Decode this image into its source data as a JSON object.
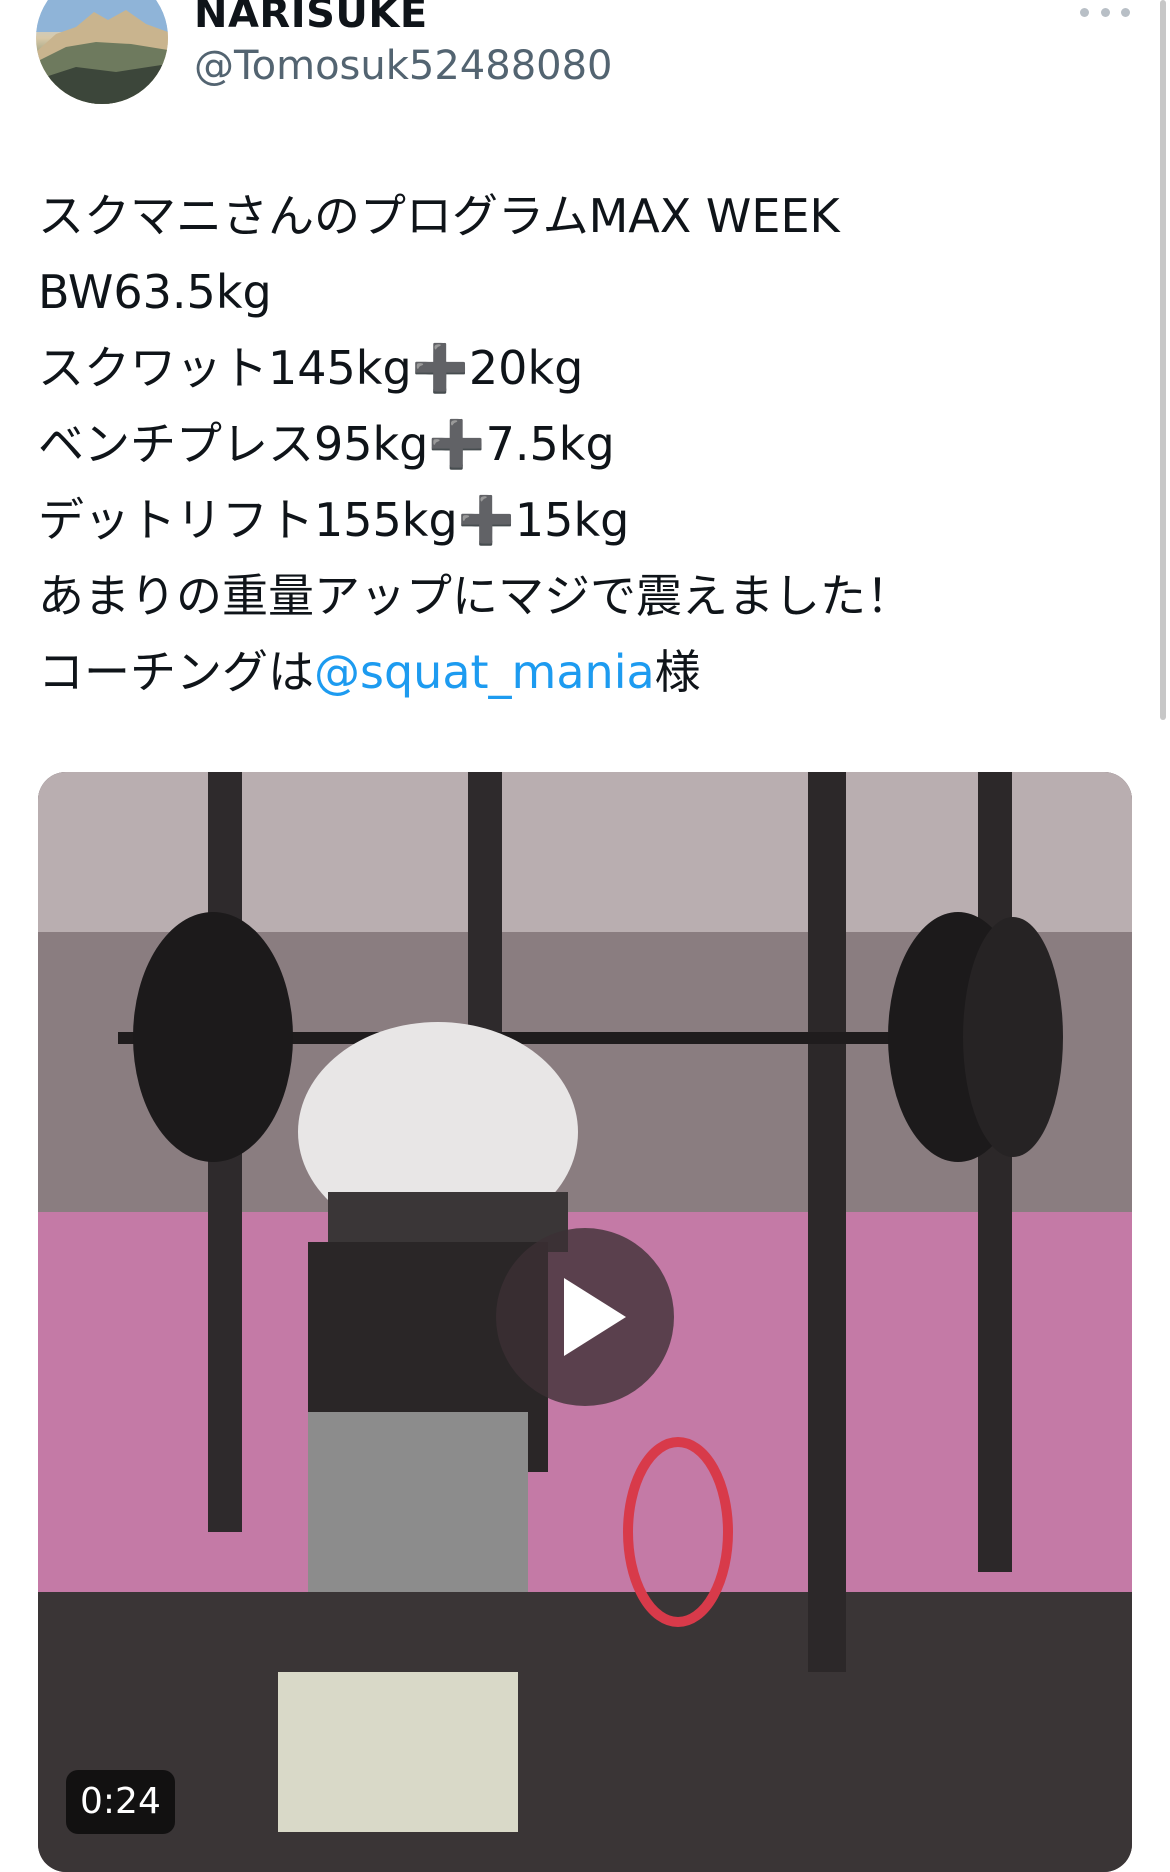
{
  "user": {
    "display_name": "NARISUKE",
    "handle": "@Tomosuk52488080",
    "avatar_icon": "mountain-landscape-avatar"
  },
  "header": {
    "more_icon": "more-dots-icon"
  },
  "tweet": {
    "lines": [
      "スクマニさんのプログラムMAX WEEK",
      "BW63.5kg",
      "スクワット145kg➕20kg",
      "ベンチプレス95kg➕7.5kg",
      "デットリフト155kg➕15kg",
      "あまりの重量アップにマジで震えました！"
    ],
    "coaching_prefix": "コーチングは",
    "mention": "@squat_mania",
    "coaching_suffix": "様"
  },
  "media": {
    "type": "video",
    "play_icon": "play-icon",
    "duration": "0:24"
  },
  "colors": {
    "mention": "#1d9bf0",
    "text": "#0f1419",
    "secondary": "#536471"
  }
}
